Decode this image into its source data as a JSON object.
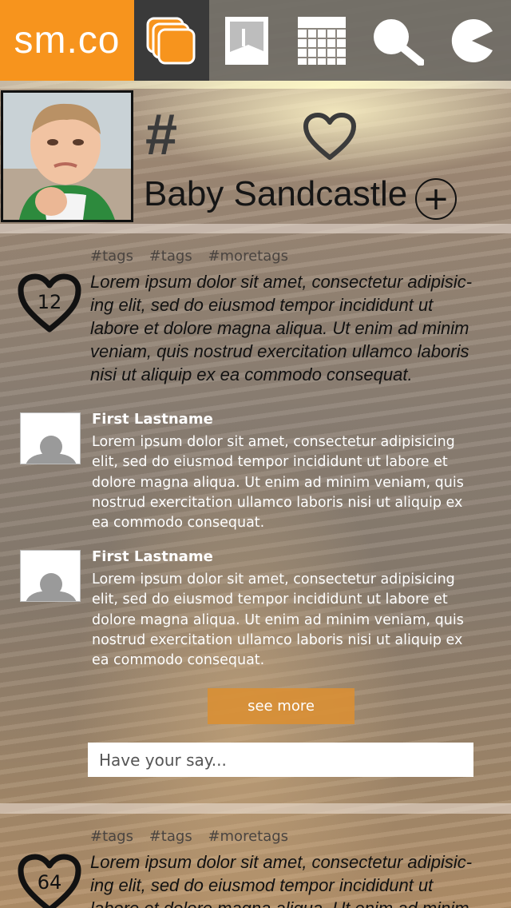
{
  "app": {
    "logo_text": "sm.co",
    "brand_color": "#f7941d"
  },
  "nav": {
    "items": [
      {
        "icon": "stack-icon",
        "active": true
      },
      {
        "icon": "image-icon",
        "active": false
      },
      {
        "icon": "calendar-grid-icon",
        "active": false
      },
      {
        "icon": "search-icon",
        "active": false
      },
      {
        "icon": "pacman-icon",
        "active": false
      }
    ]
  },
  "header": {
    "hash_symbol": "#",
    "title": "Baby Sandcastle",
    "add_symbol": "+"
  },
  "posts": [
    {
      "tags": [
        "#tags",
        "#tags",
        "#moretags"
      ],
      "likes": "12",
      "body": "Lorem ipsum dolor sit amet, consectetur adipisic-ing elit, sed do eiusmod tempor incididunt ut labore et dolore magna aliqua. Ut enim ad minim veniam, quis nostrud exercitation ullamco laboris nisi ut aliquip ex ea commodo consequat.",
      "comments": [
        {
          "name": "First Lastname",
          "text": "Lorem ipsum dolor sit amet, consectetur adipisicing elit, sed do eiusmod tempor incididunt ut labore et dolore magna aliqua. Ut enim ad minim veniam, quis nostrud exercitation ullamco laboris nisi ut aliquip ex ea commodo consequat."
        },
        {
          "name": "First Lastname",
          "text": "Lorem ipsum dolor sit amet, consectetur adipisicing elit, sed do eiusmod tempor incididunt ut labore et dolore magna aliqua. Ut enim ad minim veniam, quis nostrud exercitation ullamco laboris nisi ut aliquip ex ea commodo consequat."
        }
      ],
      "see_more_label": "see more",
      "reply_placeholder": "Have your say..."
    },
    {
      "tags": [
        "#tags",
        "#tags",
        "#moretags"
      ],
      "likes": "64",
      "body": "Lorem ipsum dolor sit amet, consectetur adipisic-ing elit, sed do eiusmod tempor incididunt ut labore et dolore magna aliqua. Ut enim ad minim"
    }
  ]
}
